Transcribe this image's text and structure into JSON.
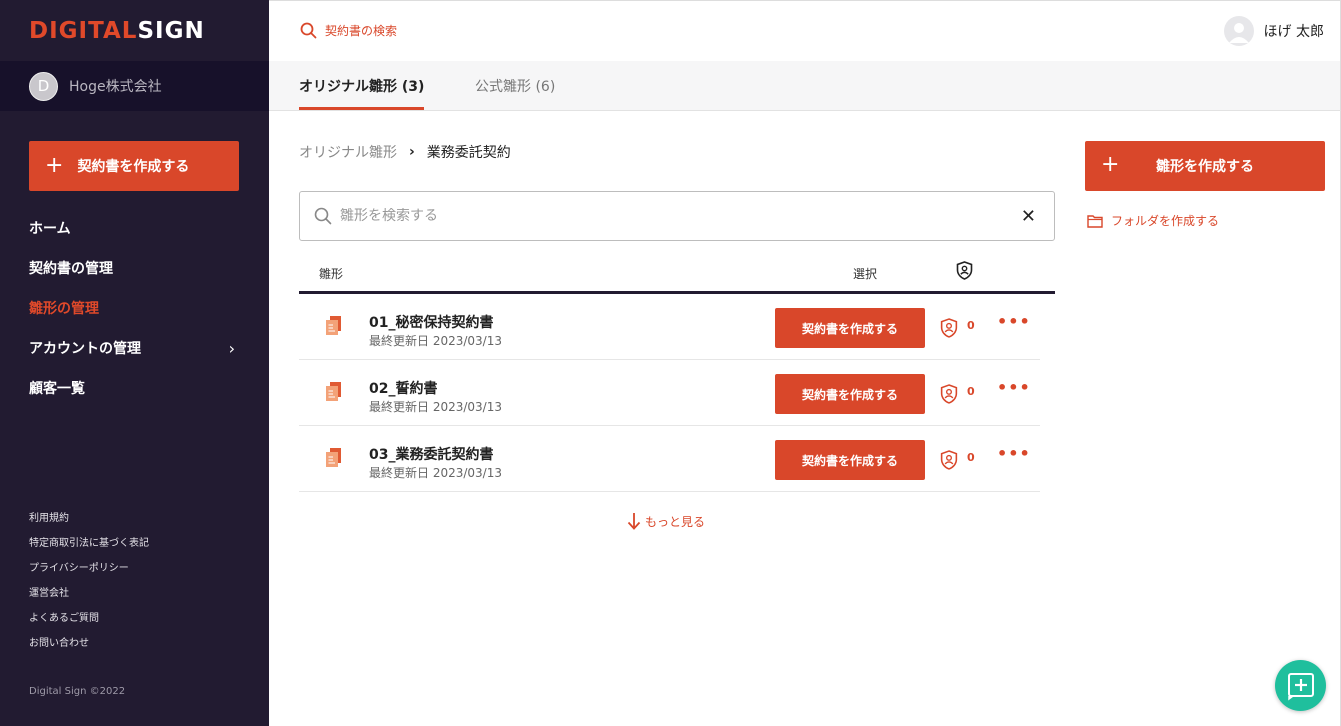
{
  "app": {
    "logo_digital": "DIGITAL",
    "logo_sign": "SIGN"
  },
  "company": {
    "initial": "D",
    "name": "Hoge株式会社"
  },
  "sidebar": {
    "create_contract_label": "契約書を作成する",
    "items": [
      {
        "label": "ホーム"
      },
      {
        "label": "契約書の管理"
      },
      {
        "label": "雛形の管理",
        "active": true
      },
      {
        "label": "アカウントの管理",
        "has_chevron": true
      },
      {
        "label": "顧客一覧"
      }
    ],
    "footer_links": [
      "利用規約",
      "特定商取引法に基づく表記",
      "プライバシーポリシー",
      "運営会社",
      "よくあるご質問",
      "お問い合わせ"
    ],
    "copyright": "Digital Sign ©2022"
  },
  "topbar": {
    "search_label": "契約書の検索",
    "user_name": "ほげ 太郎"
  },
  "tabs": [
    {
      "label": "オリジナル雛形 (3)",
      "active": true
    },
    {
      "label": "公式雛形 (6)",
      "active": false
    }
  ],
  "breadcrumb": {
    "parent": "オリジナル雛形",
    "current": "業務委託契約"
  },
  "search": {
    "placeholder": "雛形を検索する",
    "value": ""
  },
  "table": {
    "col_template": "雛形",
    "col_select": "選択",
    "rows": [
      {
        "title": "01_秘密保持契約書",
        "date": "最終更新日 2023/03/13",
        "button": "契約書を作成する",
        "count": "0"
      },
      {
        "title": "02_誓約書",
        "date": "最終更新日 2023/03/13",
        "button": "契約書を作成する",
        "count": "0"
      },
      {
        "title": "03_業務委託契約書",
        "date": "最終更新日 2023/03/13",
        "button": "契約書を作成する",
        "count": "0"
      }
    ],
    "see_more": "もっと見る"
  },
  "actions": {
    "create_template": "雛形を作成する",
    "create_folder": "フォルダを作成する"
  },
  "colors": {
    "accent": "#d9472a",
    "sidebar_bg": "#221b31",
    "fab": "#1fbf9d"
  }
}
